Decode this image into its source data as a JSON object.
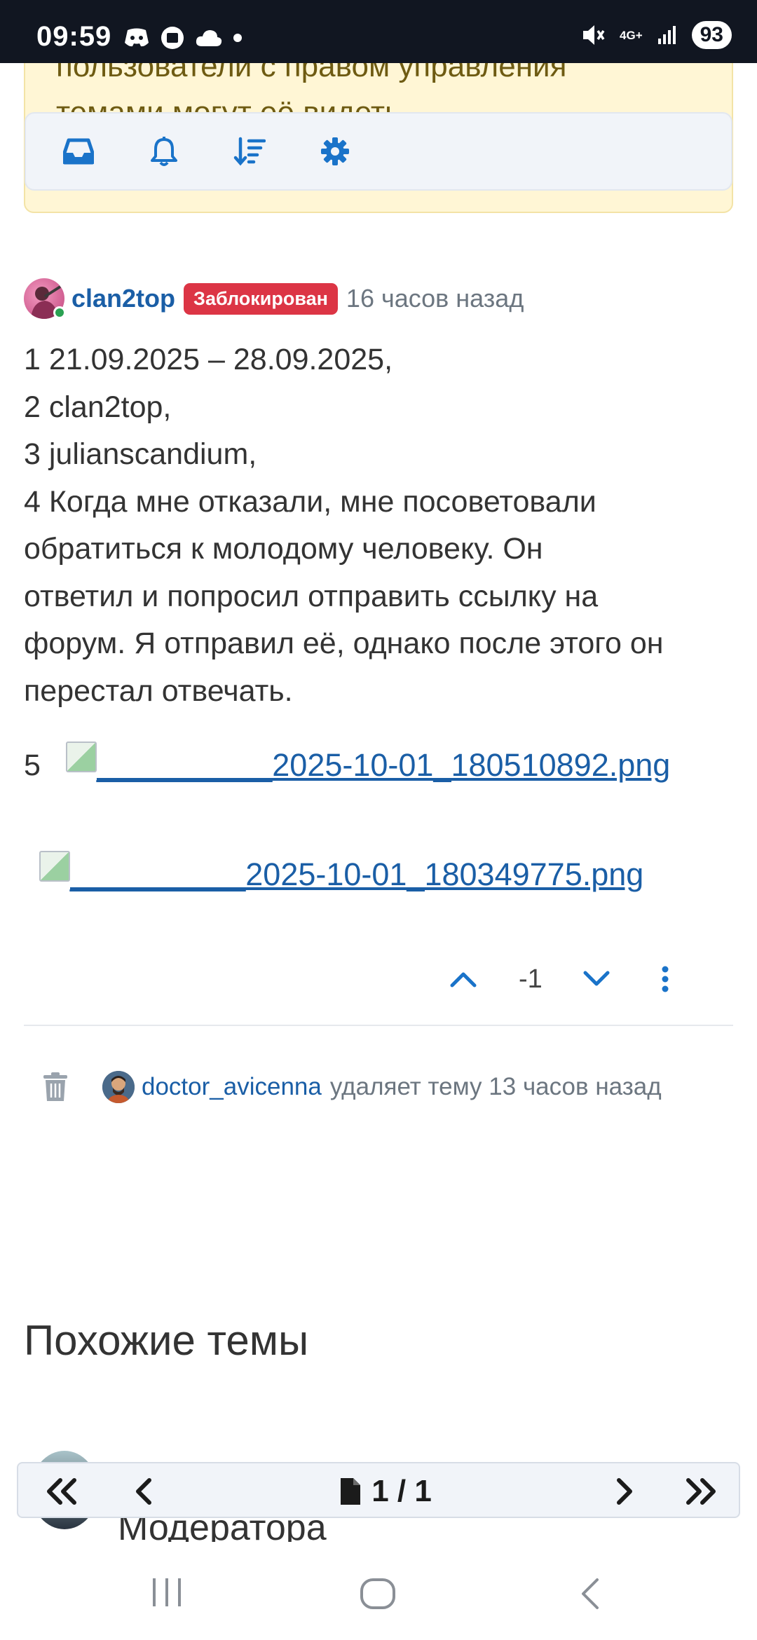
{
  "status_bar": {
    "time": "09:59",
    "left_icons": [
      "discord-icon",
      "stop-icon",
      "cloud-icon",
      "dot-icon"
    ],
    "right_icons": [
      "mute-icon",
      "signal-icon"
    ],
    "network": "4G+",
    "battery": "93"
  },
  "notice": {
    "line1": "пользователи с правом управления",
    "line2": "темами могут её видеть"
  },
  "toolbar": {
    "icons": [
      "inbox-icon",
      "bell-icon",
      "sort-icon",
      "gear-icon"
    ]
  },
  "post": {
    "username": "clan2top",
    "badge": "Заблокирован",
    "time": "16 часов назад",
    "lines": [
      "1 21.09.2025 – 28.09.2025,",
      "2 clan2top,",
      "3 julianscandium,",
      "4 Когда мне отказали, мне посоветовали",
      "обратиться к молодому человеку. Он",
      "ответил и попросил отправить ссылку на",
      "форум. Я отправил её, однако после этого он",
      "перестал отвечать."
    ],
    "attachment_number": "5",
    "attachments": [
      "__________2025-10-01_180510892.png",
      "__________2025-10-01_180349775.png"
    ],
    "vote_count": "-1"
  },
  "event": {
    "user": "doctor_avicenna",
    "text": "удаляет тему 13 часов назад"
  },
  "similar": {
    "title": "Похожие темы",
    "first_item_text": "Модератора"
  },
  "pager": {
    "label": "1 / 1"
  },
  "colors": {
    "status_bar_bg": "#111621",
    "link": "#1a5ea6",
    "badge_bg": "#dc3545",
    "notice_bg": "#fff6d5",
    "icon_blue": "#1a73c9"
  }
}
